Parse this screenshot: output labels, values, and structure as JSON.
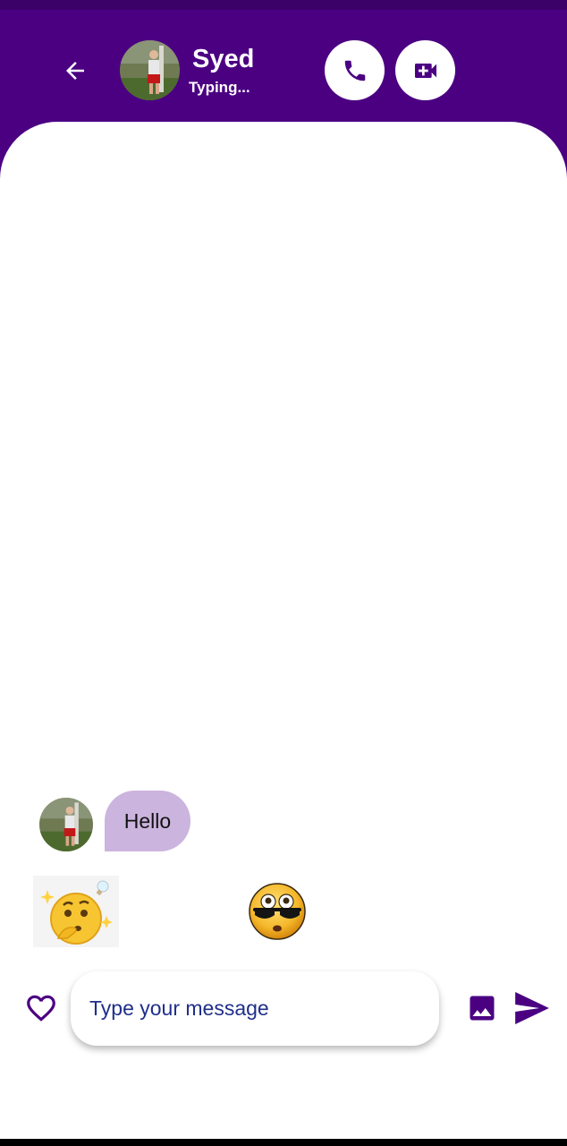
{
  "header": {
    "contact_name": "Syed",
    "contact_status": "Typing..."
  },
  "icons": {
    "back": "arrow-left-icon",
    "call": "phone-icon",
    "video": "video-camera-icon",
    "favorite": "heart-icon",
    "attach_image": "image-icon",
    "send": "send-icon"
  },
  "messages": [
    {
      "type": "text",
      "from": "Syed",
      "text": "Hello"
    },
    {
      "type": "sticker",
      "sticker": "thinking-face-with-lightbulb"
    },
    {
      "type": "sticker",
      "sticker": "face-with-sunglasses"
    }
  ],
  "composer": {
    "placeholder": "Type your message",
    "value": ""
  },
  "colors": {
    "primary": "#4b0082",
    "bubble_incoming": "#cbb4de",
    "background": "#ffffff"
  }
}
